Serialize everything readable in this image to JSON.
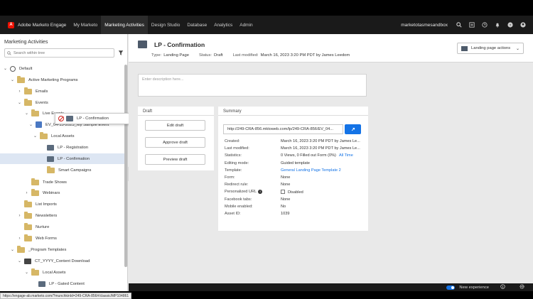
{
  "topnav": {
    "logo_glyph": "A",
    "brand": "Adobe Marketo Engage",
    "items": [
      "My Marketo",
      "Marketing Activities",
      "Design Studio",
      "Database",
      "Analytics",
      "Admin"
    ],
    "sandbox": "marketotasmesandbox",
    "icons": [
      "search-icon",
      "list-icon",
      "clock-icon",
      "bell-icon",
      "help-icon",
      "user-icon"
    ]
  },
  "left": {
    "title": "Marketing Activities",
    "search_placeholder": "Search within tree",
    "tree": [
      {
        "label": "Default",
        "icon": "globe",
        "chev": "v"
      },
      {
        "label": "Active Marketing Programs",
        "icon": "folder",
        "chev": "v"
      },
      {
        "label": "Emails",
        "icon": "folder",
        "chev": ">"
      },
      {
        "label": "Events",
        "icon": "folder",
        "chev": "v"
      },
      {
        "label": "Live Events",
        "icon": "folder",
        "chev": "v"
      },
      {
        "label": "EV_04-15-2023_My Sample Event",
        "icon": "calendar",
        "chev": "v"
      },
      {
        "label": "Local Assets",
        "icon": "folder",
        "chev": "v"
      },
      {
        "label": "LP - Registration",
        "icon": "page",
        "chev": ""
      },
      {
        "label": "LP - Confirmation",
        "icon": "page",
        "chev": "",
        "selected": true
      },
      {
        "label": "Smart Campaigns",
        "icon": "folder",
        "chev": ""
      },
      {
        "label": "Trade Shows",
        "icon": "folder",
        "chev": ""
      },
      {
        "label": "Webinars",
        "icon": "folder",
        "chev": ">"
      },
      {
        "label": "List Imports",
        "icon": "folder",
        "chev": ""
      },
      {
        "label": "Newsletters",
        "icon": "folder",
        "chev": ">"
      },
      {
        "label": "Nurture",
        "icon": "folder",
        "chev": ""
      },
      {
        "label": "Web Forms",
        "icon": "folder",
        "chev": ">"
      },
      {
        "label": "_Program Templates",
        "icon": "folder",
        "chev": "v"
      },
      {
        "label": "CT_YYYY_Content Download",
        "icon": "kit",
        "chev": "v"
      },
      {
        "label": "Local Assets",
        "icon": "folder",
        "chev": "v"
      },
      {
        "label": "LP - Gated Content",
        "icon": "page",
        "chev": ""
      }
    ],
    "drag_label": "LP - Confirmation"
  },
  "header": {
    "title": "LP - Confirmation",
    "type_label": "Type:",
    "type_value": "Landing Page",
    "status_label": "Status:",
    "status_value": "Draft",
    "modified_label": "Last modified:",
    "modified_value": "March 16, 2023 3:20 PM PDT by James Leedom",
    "actions": "Landing page actions"
  },
  "description_placeholder": "Enter description here...",
  "draft": {
    "title": "Draft",
    "buttons": [
      "Edit draft",
      "Approve draft",
      "Preview draft"
    ]
  },
  "summary": {
    "title": "Summary",
    "url": "http://249-CRA-856.mktoweb.com/lp/249-CRA-856/EV_04...",
    "rows": [
      {
        "k": "Created:",
        "v": "March 16, 2023 3:20 PM PDT by James Le..."
      },
      {
        "k": "Last modified:",
        "v": "March 16, 2023 3:20 PM PDT by James Le..."
      },
      {
        "k": "Statistics:",
        "v": "0 Views, 0 Filled out Form (0%)",
        "link": "All Time"
      },
      {
        "k": "Editing mode:",
        "v": "Guided template"
      },
      {
        "k": "Template:",
        "v": "General Landing Page Template 2",
        "is_link": true
      },
      {
        "k": "Form:",
        "v": "None"
      },
      {
        "k": "Redirect rule:",
        "v": "None"
      },
      {
        "k": "Personalized URL",
        "v": "Disabled",
        "info": true,
        "checkbox": true
      },
      {
        "k": "Facebook tabs:",
        "v": "None"
      },
      {
        "k": "Mobile enabled:",
        "v": "No"
      },
      {
        "k": "Asset ID:",
        "v": "1039"
      }
    ]
  },
  "bottom": {
    "toggle_label": "New experience"
  },
  "status_url": "https://engage-ab.marketo.com/?munchkinId=249-CRA-856#/classic/MP104861",
  "colors": {
    "accent": "#1473e6",
    "nav_bg": "#1a1a1a",
    "folder": "#d6b766",
    "selected_row": "#dde6f3"
  }
}
